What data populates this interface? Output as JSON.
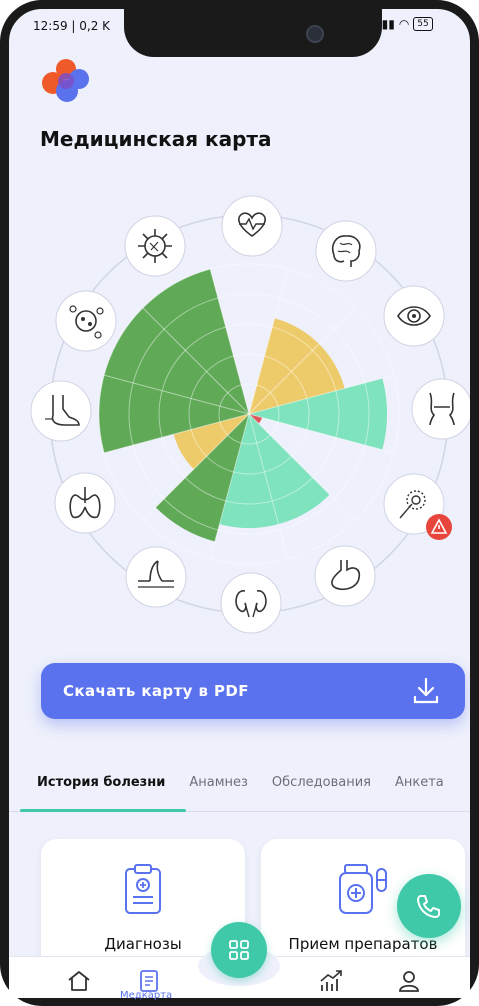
{
  "status_bar": {
    "time": "12:59 | 0,2 K",
    "battery": "55"
  },
  "header": {
    "title": "Медицинская карта"
  },
  "chart_data": {
    "type": "polar-area",
    "rings": 5,
    "colors": {
      "green": "#5fa957",
      "yellow": "#eecb6a",
      "mint": "#7fe3bd",
      "red": "#e0575b"
    },
    "sectors": [
      {
        "organ": "heart",
        "value": 0,
        "color": "#5fa957"
      },
      {
        "organ": "brain",
        "value": 3.3,
        "color": "#eecb6a"
      },
      {
        "organ": "eye",
        "value": 3.3,
        "color": "#eecb6a"
      },
      {
        "organ": "throat",
        "value": 4.6,
        "color": "#7fe3bd"
      },
      {
        "organ": "reproductive",
        "value": 0.45,
        "color": "#e0575b"
      },
      {
        "organ": "stomach",
        "value": 3.8,
        "color": "#7fe3bd"
      },
      {
        "organ": "kidneys",
        "value": 3.8,
        "color": "#7fe3bd"
      },
      {
        "organ": "hair",
        "value": 4.4,
        "color": "#5fa957"
      },
      {
        "organ": "lungs",
        "value": 2.6,
        "color": "#eecb6a"
      },
      {
        "organ": "foot",
        "value": 5,
        "color": "#5fa957"
      },
      {
        "organ": "cells",
        "value": 5,
        "color": "#5fa957"
      },
      {
        "organ": "virus",
        "value": 5,
        "color": "#5fa957"
      }
    ]
  },
  "download": {
    "label": "Скачать карту в PDF",
    "icon": "download-icon"
  },
  "tabs": [
    {
      "label": "История болезни",
      "active": true
    },
    {
      "label": "Анамнез",
      "active": false
    },
    {
      "label": "Обследования",
      "active": false
    },
    {
      "label": "Анкета",
      "active": false
    }
  ],
  "cards": [
    {
      "label": "Диагнозы",
      "icon": "clipboard-icon"
    },
    {
      "label": "Прием препаратов",
      "icon": "medicine-icon"
    }
  ],
  "bottom_nav": {
    "medcard_label": "Медкарта"
  },
  "accent": "#3fc9a9",
  "primary": "#5b72ee"
}
